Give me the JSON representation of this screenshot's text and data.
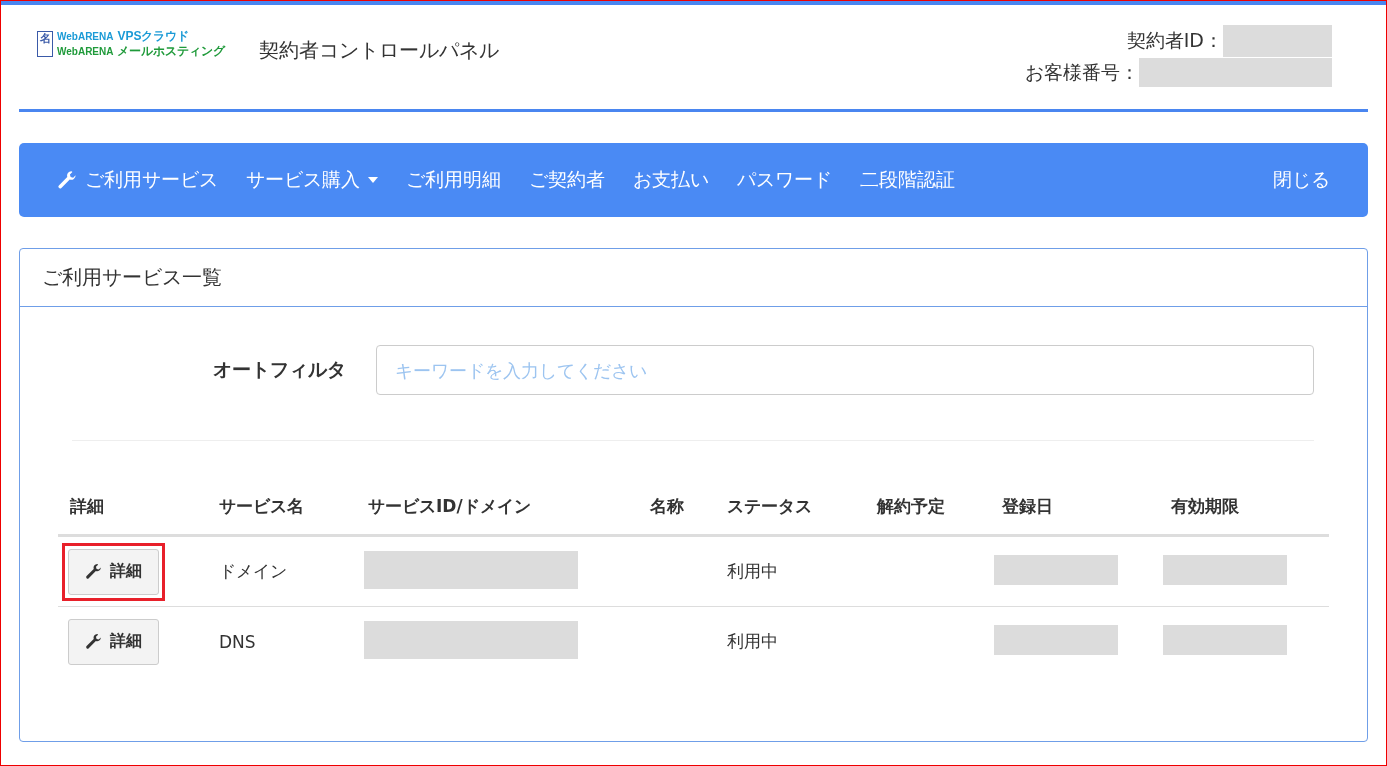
{
  "logo": {
    "mark": "名",
    "lines": [
      {
        "brand": "WebARENA",
        "product": "VPSクラウド",
        "color": "#1a9ad6"
      },
      {
        "brand": "WebARENA",
        "product": "メールホスティング",
        "color": "#1f9a3a"
      }
    ]
  },
  "header": {
    "title": "契約者コントロールパネル",
    "fields": [
      {
        "label": "契約者ID："
      },
      {
        "label": "お客様番号："
      }
    ]
  },
  "nav": {
    "items": [
      {
        "label": "ご利用サービス",
        "kind": "icon"
      },
      {
        "label": "サービス購入",
        "kind": "dropdown"
      },
      {
        "label": "ご利用明細",
        "kind": "plain"
      },
      {
        "label": "ご契約者",
        "kind": "plain"
      },
      {
        "label": "お支払い",
        "kind": "plain"
      },
      {
        "label": "パスワード",
        "kind": "plain"
      },
      {
        "label": "二段階認証",
        "kind": "plain"
      }
    ],
    "close": "閉じる"
  },
  "panel": {
    "title": "ご利用サービス一覧",
    "filter": {
      "label": "オートフィルタ",
      "placeholder": "キーワードを入力してください"
    },
    "table": {
      "columns": [
        "詳細",
        "サービス名",
        "サービスID/ドメイン",
        "名称",
        "ステータス",
        "解約予定",
        "登録日",
        "有効期限"
      ],
      "rows": [
        {
          "button": "詳細",
          "highlighted": true,
          "service": "ドメイン",
          "status": "利用中"
        },
        {
          "button": "詳細",
          "highlighted": false,
          "service": "DNS",
          "status": "利用中"
        }
      ]
    }
  }
}
